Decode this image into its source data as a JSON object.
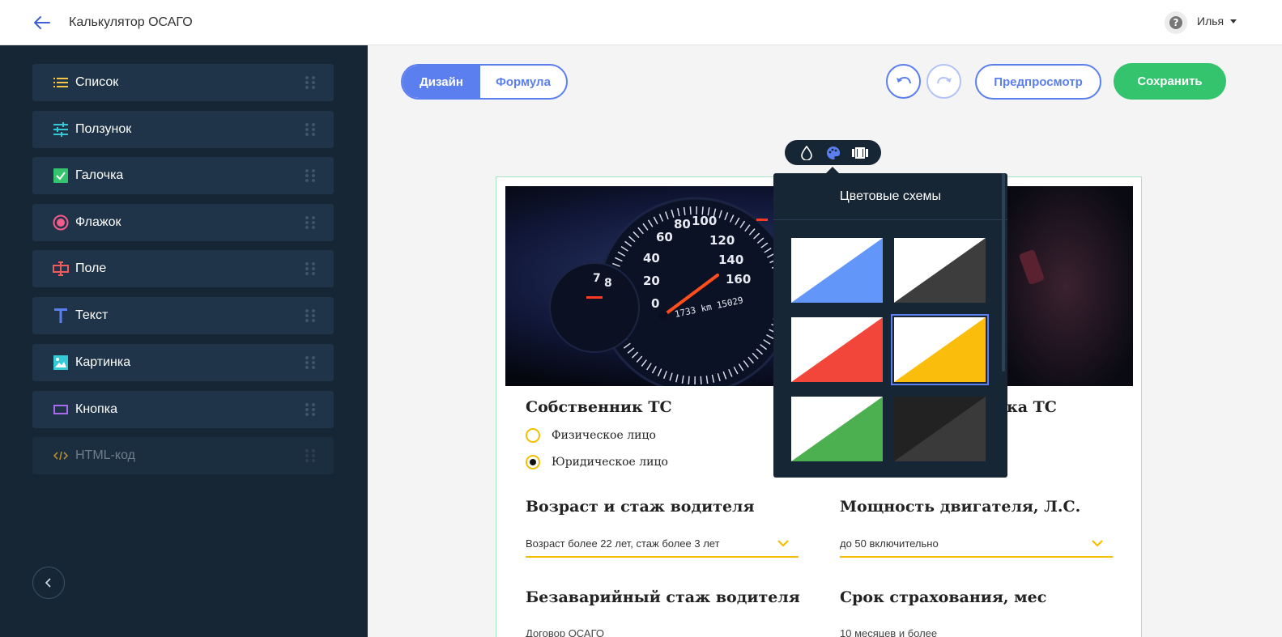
{
  "header": {
    "title": "Калькулятор ОСАГО",
    "user_name": "Илья",
    "help_symbol": "?"
  },
  "sidebar": {
    "items": [
      {
        "label": "Список",
        "icon": "list-icon",
        "color": "#f6c744"
      },
      {
        "label": "Ползунок",
        "icon": "sliders-icon",
        "color": "#34c9d6"
      },
      {
        "label": "Галочка",
        "icon": "checkbox-icon",
        "color": "#34c46e"
      },
      {
        "label": "Флажок",
        "icon": "radio-icon",
        "color": "#f25b8a"
      },
      {
        "label": "Поле",
        "icon": "input-field-icon",
        "color": "#f25b5b"
      },
      {
        "label": "Текст",
        "icon": "text-icon",
        "color": "#5b7fee"
      },
      {
        "label": "Картинка",
        "icon": "image-icon",
        "color": "#34c9d6"
      },
      {
        "label": "Кнопка",
        "icon": "button-icon",
        "color": "#a86bf0"
      },
      {
        "label": "HTML-код",
        "icon": "code-icon",
        "color": "#b58a2e",
        "disabled": true
      }
    ]
  },
  "toolbar": {
    "design_label": "Дизайн",
    "formula_label": "Формула",
    "preview_label": "Предпросмотр",
    "save_label": "Сохранить"
  },
  "color_panel": {
    "title": "Цветовые схемы",
    "schemes": [
      {
        "name": "blue",
        "color": "#6296f8"
      },
      {
        "name": "dark-grey",
        "color": "#3d3d3d"
      },
      {
        "name": "red",
        "color": "#f2463a"
      },
      {
        "name": "yellow",
        "color": "#fbbd0b",
        "selected": true
      },
      {
        "name": "green",
        "color": "#4caf50"
      },
      {
        "name": "black",
        "color": "#3a3a3a"
      }
    ]
  },
  "form": {
    "owner_title": "Собственник ТС",
    "owner_options": [
      "Физическое лицо",
      "Юридическое лицо"
    ],
    "owner_selected": "Юридическое лицо",
    "right_title_fragment": "ка ТС",
    "driver_title": "Возраст и стаж водителя",
    "driver_value": "Возраст более 22 лет, стаж более 3 лет",
    "power_title": "Мощность двигателя, Л.С.",
    "power_value": "до 50 включительно",
    "accident_free_title": "Безаварийный стаж водителя",
    "accident_free_value": "Договор ОСАГО",
    "term_title": "Срок страхования, мес",
    "term_value": "10 месяцев и более"
  },
  "hero_image": {
    "dial_numbers": [
      "0",
      "20",
      "40",
      "60",
      "80",
      "100",
      "120",
      "140",
      "160"
    ],
    "odometer": "1733 km 15029",
    "tacho_numbers": [
      "7",
      "8"
    ]
  },
  "colors": {
    "accent": "#5b7fee",
    "save": "#34c46e",
    "field_accent": "#f6be00",
    "sidebar_bg": "#162635"
  }
}
